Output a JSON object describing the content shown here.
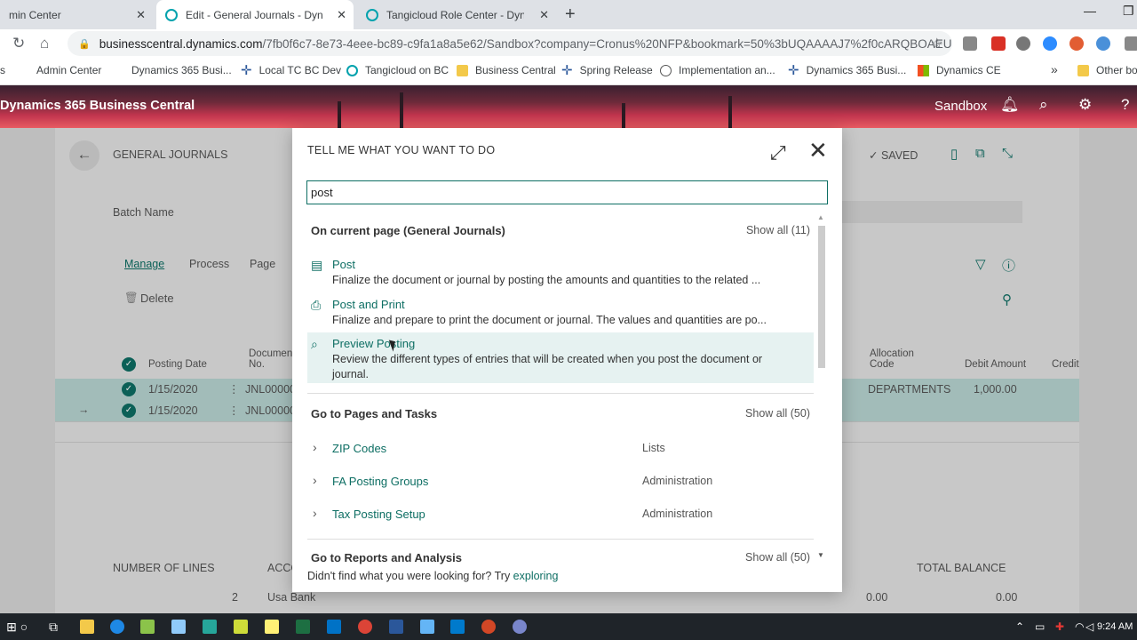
{
  "browser": {
    "tabs": [
      {
        "title": "min Center",
        "close": "✕"
      },
      {
        "title": "Edit - General Journals - Dynamic",
        "close": "✕"
      },
      {
        "title": "Tangicloud Role Center - Dynam",
        "close": "✕"
      }
    ],
    "new_tab": "+",
    "url_host": "businesscentral.dynamics.com",
    "url_path": "/7fb0f6c7-8e73-4eee-bc89-c9fa1a8a5e62/Sandbox?company=Cronus%20NFP&bookmark=50%3bUQAAAAJ7%2f0cARQBOAEU...",
    "bookmarks": [
      {
        "label": "s",
        "icon": "none"
      },
      {
        "label": "Admin Center",
        "icon": "none"
      },
      {
        "label": "Dynamics 365 Busi...",
        "icon": "none"
      },
      {
        "label": "Local TC BC Dev",
        "icon": "plus"
      },
      {
        "label": "Tangicloud on BC",
        "icon": "globe"
      },
      {
        "label": "Business Central",
        "icon": "folder"
      },
      {
        "label": "Spring Release",
        "icon": "plus"
      },
      {
        "label": "Implementation an...",
        "icon": "world"
      },
      {
        "label": "Dynamics 365 Busi...",
        "icon": "plus"
      },
      {
        "label": "Dynamics CE",
        "icon": "ms"
      },
      {
        "label": "»",
        "icon": "none"
      },
      {
        "label": "Other bo",
        "icon": "folder"
      }
    ]
  },
  "bc_header": {
    "app_name": "Dynamics 365 Business Central",
    "environment": "Sandbox"
  },
  "background_page": {
    "title": "GENERAL JOURNALS",
    "saved": "✓ SAVED",
    "batch_name_label": "Batch Name",
    "actions": [
      "Manage",
      "Process",
      "Page"
    ],
    "delete_label": "Delete",
    "columns": [
      "Posting Date",
      "Document No.",
      "Allocation Code",
      "Debit Amount",
      "Credit"
    ],
    "rows": [
      {
        "date": "1/15/2020",
        "doc": "JNL00000",
        "alloc": "DEPARTMENTS",
        "debit": "1,000.00"
      },
      {
        "date": "1/15/2020",
        "doc": "JNL00000",
        "alloc": "",
        "debit": ""
      }
    ],
    "footer_labels": {
      "lines": "NUMBER OF LINES",
      "acc": "ACCO",
      "total": "TOTAL BALANCE"
    },
    "footer_values": {
      "count": "2",
      "acc_name": "Usa Bank",
      "balance1": "0.00",
      "balance2": "0.00"
    }
  },
  "dialog": {
    "title": "TELL ME WHAT YOU WANT TO DO",
    "search_value": "post",
    "sections": {
      "current_page": {
        "header": "On current page (General Journals)",
        "show_all": "Show all (11)"
      },
      "pages_tasks": {
        "header": "Go to Pages and Tasks",
        "show_all": "Show all (50)"
      },
      "reports": {
        "header": "Go to Reports and Analysis",
        "show_all": "Show all (50)"
      }
    },
    "actions": [
      {
        "label": "Post",
        "desc": "Finalize the document or journal by posting the amounts and quantities to the related ...",
        "icon": "post-icon"
      },
      {
        "label": "Post and Print",
        "desc": "Finalize and prepare to print the document or journal. The values and quantities are po...",
        "icon": "print-icon"
      },
      {
        "label": "Preview Posting",
        "desc": "Review the different types of entries that will be created when you post the document or journal.",
        "icon": "preview-icon"
      }
    ],
    "pages": [
      {
        "label": "ZIP Codes",
        "category": "Lists"
      },
      {
        "label": "FA Posting Groups",
        "category": "Administration"
      },
      {
        "label": "Tax Posting Setup",
        "category": "Administration"
      }
    ],
    "footer_text": "Didn't find what you were looking for? Try ",
    "footer_link": "exploring"
  },
  "taskbar": {
    "clock": "9:24 AM"
  }
}
